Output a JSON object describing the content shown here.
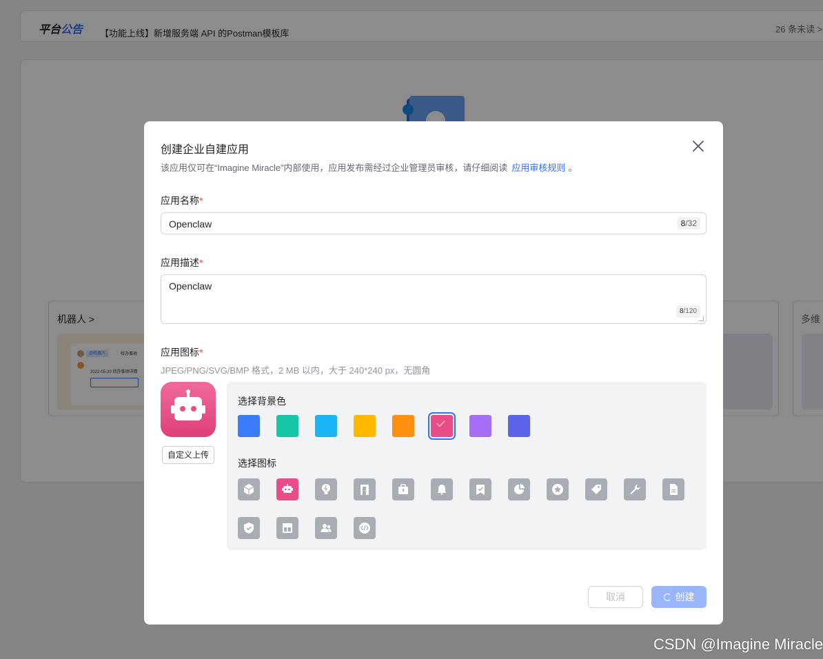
{
  "notice": {
    "logo_part1": "平台",
    "logo_part2": "公告",
    "text": "【功能上线】新增服务端 API 的Postman模板库",
    "unread": "26 条未读 >"
  },
  "cards": {
    "robot_title": "机器人 >",
    "robot_preview_chip": "@机器人",
    "robot_preview_chip2": "待办事项",
    "robot_preview_line": "2022-05-20 待办事项详情",
    "right_title": "多维"
  },
  "modal": {
    "title": "创建企业自建应用",
    "subtitle": "该应用仅可在“Imagine Miracle”内部使用，应用发布需经过企业管理员审核，请仔细阅读",
    "subtitle_link": "应用审核规则",
    "subtitle_end": "。",
    "name_label": "应用名称",
    "name_value": "Openclaw",
    "name_count_cur": "8",
    "name_count_max": "/32",
    "desc_label": "应用描述",
    "desc_value": "Openclaw",
    "desc_count_cur": "8",
    "desc_count_max": "/120",
    "icon_label": "应用图标",
    "required_mark": "*",
    "icon_hint": "JPEG/PNG/SVG/BMP 格式，2 MB 以内，大于 240*240 px，无圆角",
    "upload_label": "自定义上传",
    "bg_picker_title": "选择背景色",
    "icon_picker_title": "选择图标",
    "cancel_label": "取消",
    "create_label": "创建"
  },
  "bg_colors": [
    "#3a7bf7",
    "#14c6a3",
    "#1ab4f5",
    "#ffb800",
    "#ff8f0e",
    "#e84d87",
    "#a46ef5",
    "#5b63e8"
  ],
  "selected_bg_color": "#e84d87",
  "icon_options": [
    "cube-icon",
    "robot-icon",
    "lightbulb-icon",
    "door-icon",
    "briefcase-icon",
    "bell-icon",
    "bookmark-check-icon",
    "pie-chart-icon",
    "star-icon",
    "tag-icon",
    "wrench-icon",
    "document-icon",
    "shield-check-icon",
    "layout-icon",
    "users-icon",
    "code-icon"
  ],
  "selected_icon": "robot-icon",
  "watermark": "CSDN @Imagine Miracle"
}
